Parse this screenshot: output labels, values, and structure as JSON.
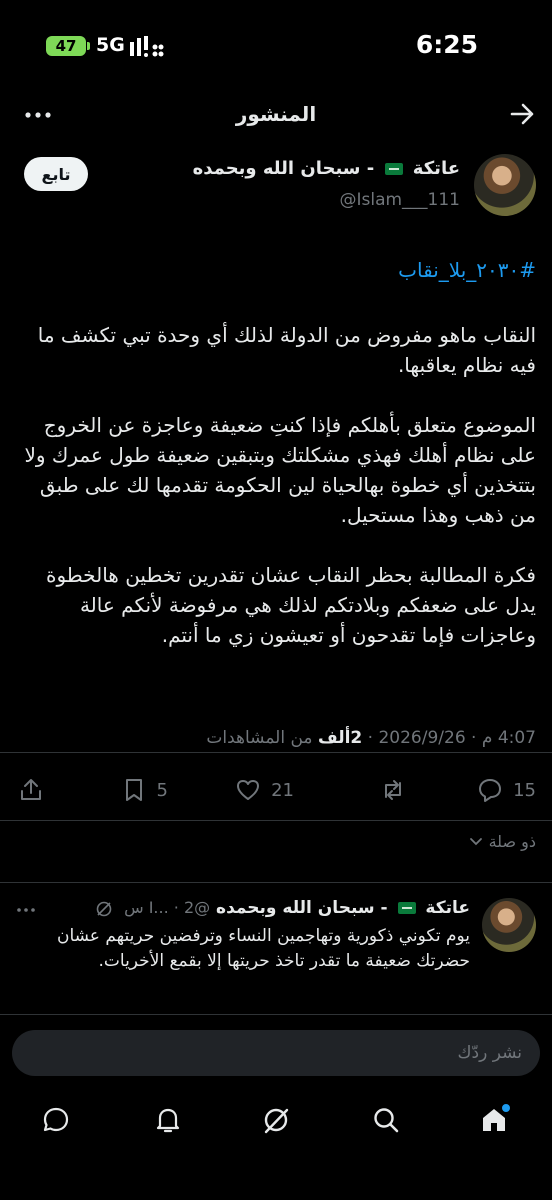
{
  "status_bar": {
    "battery": "47",
    "network": "5G",
    "time": "6:25"
  },
  "header": {
    "title": "المنشور"
  },
  "author": {
    "name": "عاتكة",
    "name_suffix": "- سبحان الله وبحمده",
    "handle": "@Islam___111",
    "follow_label": "تابع"
  },
  "post": {
    "hashtag": "#٢٠٣٠_بلا_نقاب",
    "paragraphs": [
      "النقاب ماهو مفروض من الدولة لذلك أي وحدة تبي تكشف ما فيه نظام يعاقبها.",
      "الموضوع متعلق بأهلكم فإذا كنتِ ضعيفة وعاجزة عن الخروج على نظام أهلك فهذي مشكلتك وبتبقين ضعيفة طول عمرك ولا بتتخذين أي خطوة بهالحياة لين الحكومة تقدمها لك على طبق من ذهب وهذا مستحيل.",
      "فكرة المطالبة بحظر النقاب عشان تقدرين تخطين هالخطوة يدل على ضعفكم وبلادتكم لذلك هي مرفوضة لأنكم عالة وعاجزات فإما تقدحون أو تعيشون زي ما أنتم."
    ],
    "time": "4:07 م",
    "date": "2026/9/26",
    "views_count": "2ألف",
    "views_label": "من المشاهدات"
  },
  "actions": {
    "replies": "15",
    "reposts": "",
    "likes": "21",
    "bookmarks": "5"
  },
  "relevancy_label": "ذو صلة",
  "reply": {
    "name": "عاتكة",
    "name_suffix": "- سبحان الله وبحمده",
    "handle": "@I...",
    "time": "2 س",
    "text": "يوم تكوني ذكورية وتهاجمين النساء وترفضين حريتهم عشان حضرتك ضعيفة ما تقدر تاخذ حريتها إلا بقمع الأخريات."
  },
  "reply_box": {
    "placeholder": "نشر ردّك"
  },
  "colors": {
    "accent": "#1d9bf0",
    "background": "#000000",
    "muted": "#71767b"
  },
  "nav": [
    "home-icon",
    "search-icon",
    "grok-icon",
    "notifications-icon",
    "messages-icon"
  ]
}
